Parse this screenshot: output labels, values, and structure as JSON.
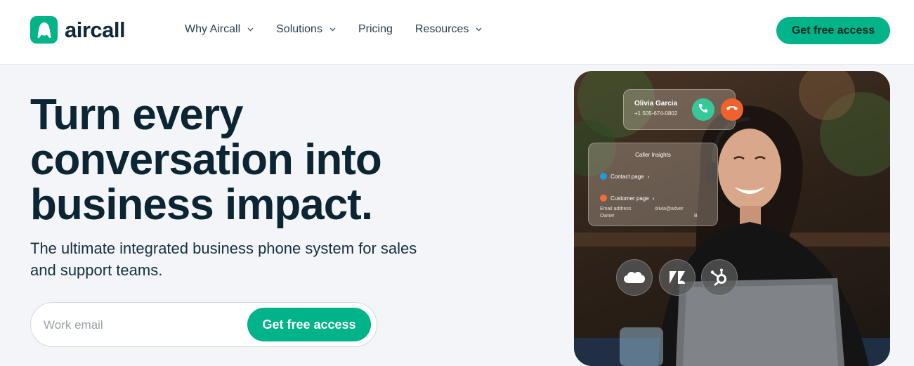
{
  "brand": {
    "name": "aircall",
    "accent": "#00b388"
  },
  "nav": {
    "items": [
      {
        "label": "Why Aircall",
        "has_dropdown": true
      },
      {
        "label": "Solutions",
        "has_dropdown": true
      },
      {
        "label": "Pricing",
        "has_dropdown": false
      },
      {
        "label": "Resources",
        "has_dropdown": true
      }
    ],
    "cta_label": "Get free access"
  },
  "hero": {
    "title": "Turn every conversation into business impact.",
    "subtitle": "The ultimate integrated business phone system for sales and support teams.",
    "form": {
      "email_placeholder": "Work email",
      "cta_label": "Get free access"
    }
  },
  "hero_image": {
    "call_card": {
      "caller_name": "Olivia Garcia",
      "caller_phone": "+1 505-674-0802",
      "accept_color": "#37c89a",
      "decline_color": "#f2612b"
    },
    "caller_insights": {
      "title": "Caller Insights",
      "rows": [
        {
          "label": "Contact page",
          "icon": "salesforce-icon",
          "color": "#1d9bd7"
        },
        {
          "label": "Customer page",
          "icon": "hubspot-icon",
          "color": "#f26c35"
        }
      ],
      "email_label": "Email address",
      "email_value": "olivia@adver",
      "owner_label": "Owner",
      "owner_value": "B"
    },
    "integrations": [
      {
        "name": "salesforce-icon",
        "text": "salesforce"
      },
      {
        "name": "zendesk-icon",
        "text": ""
      },
      {
        "name": "hubspot-icon",
        "text": ""
      }
    ]
  }
}
